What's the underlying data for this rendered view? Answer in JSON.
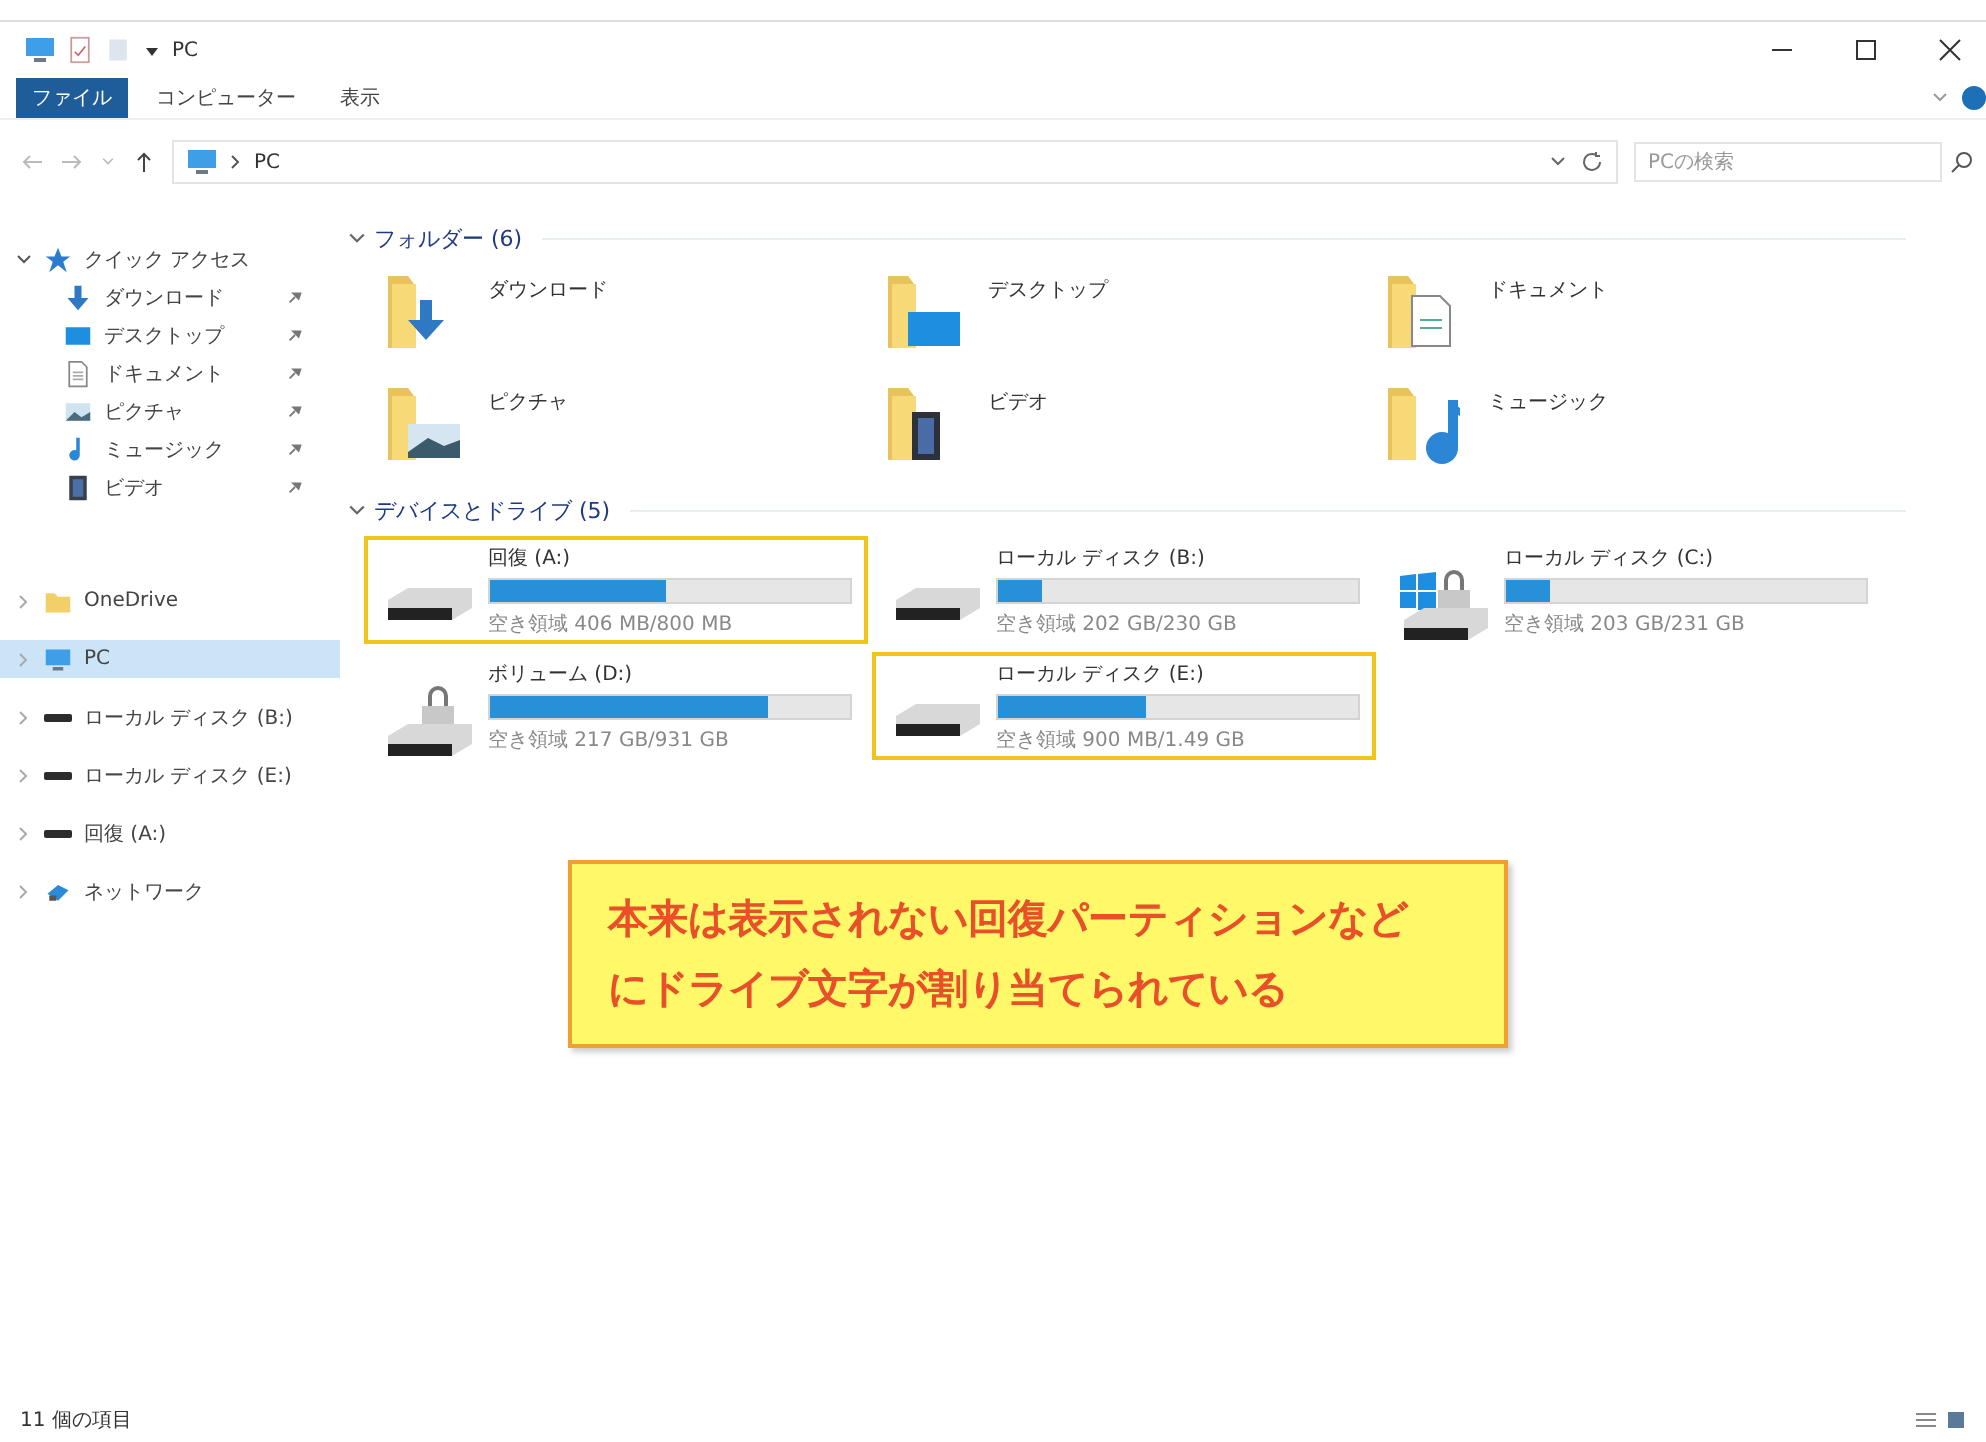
{
  "window": {
    "title": "PC"
  },
  "ribbon_tabs": [
    {
      "label": "ファイル",
      "selected": true
    },
    {
      "label": "コンピューター",
      "selected": false
    },
    {
      "label": "表示",
      "selected": false
    }
  ],
  "address_bar": {
    "path": [
      "PC"
    ]
  },
  "search": {
    "placeholder": "PCの検索"
  },
  "sidebar": {
    "items": [
      {
        "label": "クイック アクセス",
        "kind": "star",
        "expanded": true,
        "selected": false,
        "children": [
          {
            "label": "ダウンロード",
            "kind": "download",
            "pinned": true
          },
          {
            "label": "デスクトップ",
            "kind": "desktop",
            "pinned": true
          },
          {
            "label": "ドキュメント",
            "kind": "document",
            "pinned": true
          },
          {
            "label": "ピクチャ",
            "kind": "picture",
            "pinned": true
          },
          {
            "label": "ミュージック",
            "kind": "music",
            "pinned": true
          },
          {
            "label": "ビデオ",
            "kind": "video",
            "pinned": true
          }
        ]
      },
      {
        "label": "OneDrive",
        "kind": "folder",
        "expanded": false,
        "selected": false
      },
      {
        "label": "PC",
        "kind": "pc",
        "expanded": false,
        "selected": true
      },
      {
        "label": "ローカル ディスク (B:)",
        "kind": "drive",
        "expanded": false,
        "selected": false
      },
      {
        "label": "ローカル ディスク (E:)",
        "kind": "drive",
        "expanded": false,
        "selected": false
      },
      {
        "label": "回復 (A:)",
        "kind": "drive",
        "expanded": false,
        "selected": false
      },
      {
        "label": "ネットワーク",
        "kind": "network",
        "expanded": false,
        "selected": false
      }
    ]
  },
  "folders": {
    "heading": "フォルダー (6)",
    "items": [
      {
        "label": "ダウンロード",
        "kind": "download"
      },
      {
        "label": "デスクトップ",
        "kind": "desktop"
      },
      {
        "label": "ドキュメント",
        "kind": "document"
      },
      {
        "label": "ピクチャ",
        "kind": "picture"
      },
      {
        "label": "ビデオ",
        "kind": "video"
      },
      {
        "label": "ミュージック",
        "kind": "music"
      }
    ]
  },
  "drives": {
    "heading": "デバイスとドライブ (5)",
    "items": [
      {
        "label": "回復 (A:)",
        "kind": "drive",
        "level": 0.49,
        "free": "空き領域 406 MB/800 MB",
        "highlighted": true
      },
      {
        "label": "ローカル ディスク (B:)",
        "kind": "drive",
        "level": 0.12,
        "free": "空き領域 202 GB/230 GB",
        "highlighted": false
      },
      {
        "label": "ローカル ディスク (C:)",
        "kind": "system",
        "level": 0.12,
        "free": "空き領域 203 GB/231 GB",
        "highlighted": false
      },
      {
        "label": "ボリューム (D:)",
        "kind": "locked",
        "level": 0.77,
        "free": "空き領域 217 GB/931 GB",
        "highlighted": false
      },
      {
        "label": "ローカル ディスク (E:)",
        "kind": "drive",
        "level": 0.41,
        "free": "空き領域 900 MB/1.49 GB",
        "highlighted": true
      }
    ]
  },
  "callout": {
    "lines": [
      "本来は表示されない回復パーティションなど",
      "にドライブ文字が割り当てられている"
    ]
  },
  "status_bar": {
    "text": "11 個の項目"
  }
}
